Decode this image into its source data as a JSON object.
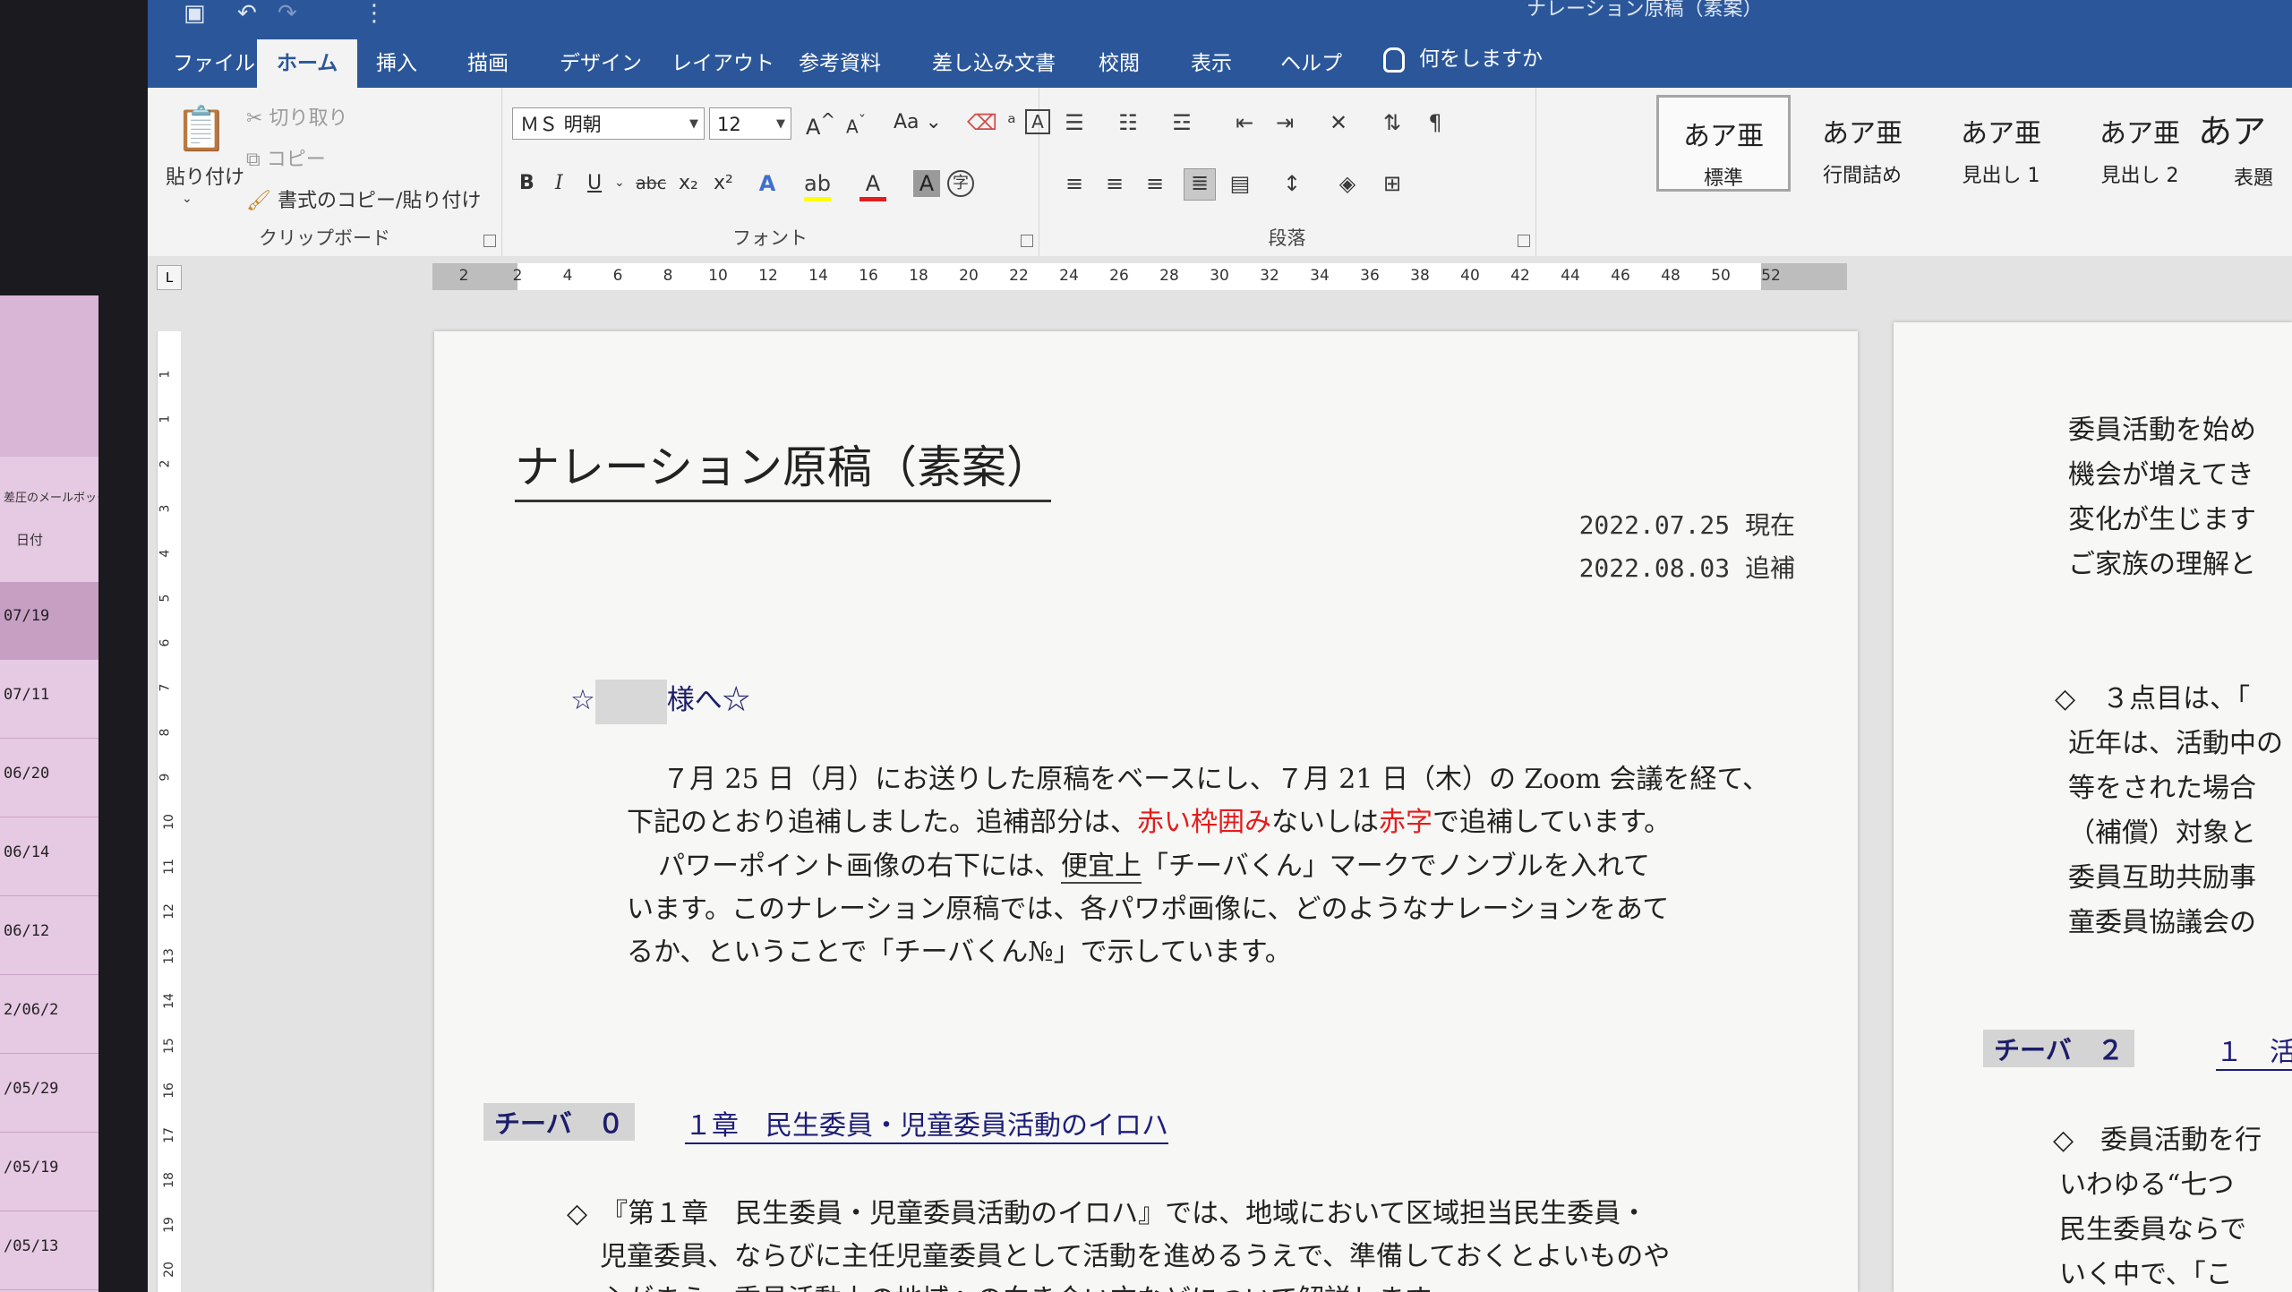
{
  "background_app": {
    "folder_label": "差圧のメールボック",
    "sort_label": "日付",
    "dates": [
      "07/19",
      "07/11",
      "06/20",
      "06/14",
      "06/12",
      "2/06/2",
      "/05/29",
      "/05/19",
      "/05/13"
    ]
  },
  "title_bar": {
    "doc_title": "ナレーション原稿（素案）",
    "save_icon": "save-icon",
    "undo_icon": "undo-icon",
    "redo_icon": "redo-icon"
  },
  "menu": {
    "tabs": [
      "ファイル",
      "ホーム",
      "挿入",
      "描画",
      "デザイン",
      "レイアウト",
      "参考資料",
      "差し込み文書",
      "校閲",
      "表示",
      "ヘルプ"
    ],
    "active_tab": "ホーム",
    "tell_me": "何をしますか"
  },
  "ribbon": {
    "clipboard": {
      "paste": "貼り付け",
      "cut": "切り取り",
      "copy": "コピー",
      "format_painter": "書式のコピー/貼り付け",
      "label": "クリップボード"
    },
    "font": {
      "font_name": "ＭＳ 明朝",
      "font_size": "12",
      "label": "フォント",
      "bold": "B",
      "italic": "I",
      "underline": "U",
      "strike": "abc",
      "subscript": "x₂",
      "superscript": "x²",
      "case": "Aa",
      "grow": "A",
      "shrink": "A",
      "font_color": "#e21d1d",
      "highlight_color": "#ffff00"
    },
    "paragraph": {
      "label": "段落"
    },
    "styles": [
      {
        "preview": "あア亜",
        "name": "標準"
      },
      {
        "preview": "あア亜",
        "name": "行間詰め"
      },
      {
        "preview": "あア亜",
        "name": "見出し 1"
      },
      {
        "preview": "あア亜",
        "name": "見出し 2"
      },
      {
        "preview": "あア",
        "name": "表題"
      }
    ]
  },
  "ruler": {
    "ticks": [
      "2",
      "2",
      "4",
      "6",
      "8",
      "10",
      "12",
      "14",
      "16",
      "18",
      "20",
      "22",
      "24",
      "26",
      "28",
      "30",
      "32",
      "34",
      "36",
      "38",
      "40",
      "42",
      "44",
      "46",
      "48",
      "50",
      "52"
    ],
    "tab_selector": "L",
    "vertical_ticks": [
      "1",
      "1",
      "2",
      "3",
      "4",
      "5",
      "6",
      "7",
      "8",
      "9",
      "10",
      "11",
      "12",
      "13",
      "14",
      "15",
      "16",
      "17",
      "18",
      "19",
      "20"
    ]
  },
  "page1": {
    "title": "ナレーション原稿（素案）",
    "date1": "2022.07.25 現在",
    "date2": "2022.08.03 追補",
    "addressee_prefix": "☆",
    "addressee_suffix": "様へ☆",
    "para1_line1": "７月 25 日（月）にお送りした原稿をベースにし、７月 21 日（木）の Zoom 会議を経て、",
    "para1_line2_a": "下記のとおり追補しました。追補部分は、",
    "para1_line2_red1": "赤い枠囲み",
    "para1_line2_b": "ないしは",
    "para1_line2_red2": "赤字",
    "para1_line2_c": "で追補しています。",
    "para2_line1_a": "パワーポイント画像の右下には、",
    "para2_line1_u": "便宜上",
    "para2_line1_b": "「チーバくん」マークでノンブルを入れて",
    "para2_line2": "います。このナレーション原稿では、各パワポ画像に、どのようなナレーションをあて",
    "para2_line3": "るか、ということで「チーバくん№」で示しています。",
    "chiba_tag": "チーバ　０",
    "chapter": "１章　民生委員・児童委員活動のイロハ",
    "section1_line1": "◇　『第１章　民生委員・児童委員活動のイロハ』では、地域において区域担当民生委員・",
    "section1_line2": "児童委員、ならびに主任児童委員として活動を進めるうえで、準備しておくとよいものや",
    "section1_line3": "心がまえ、委員活動上の地域への向き合い方などについて解説します。"
  },
  "page2": {
    "lines_top": [
      "委員活動を始め",
      "機会が増えてき",
      "変化が生じます",
      "ご家族の理解と"
    ],
    "lines_mid": [
      "◇　３点目は、「",
      "近年は、活動中の",
      "等をされた場合",
      "（補償）対象と",
      "委員互助共励事",
      "童委員協議会の"
    ],
    "chiba_tag": "チーバ　２",
    "chapter": "１　活",
    "lines_bottom": [
      "◇　委員活動を行",
      "いわゆる“七つ",
      "民生委員ならで",
      "いく中で、「こ"
    ]
  }
}
